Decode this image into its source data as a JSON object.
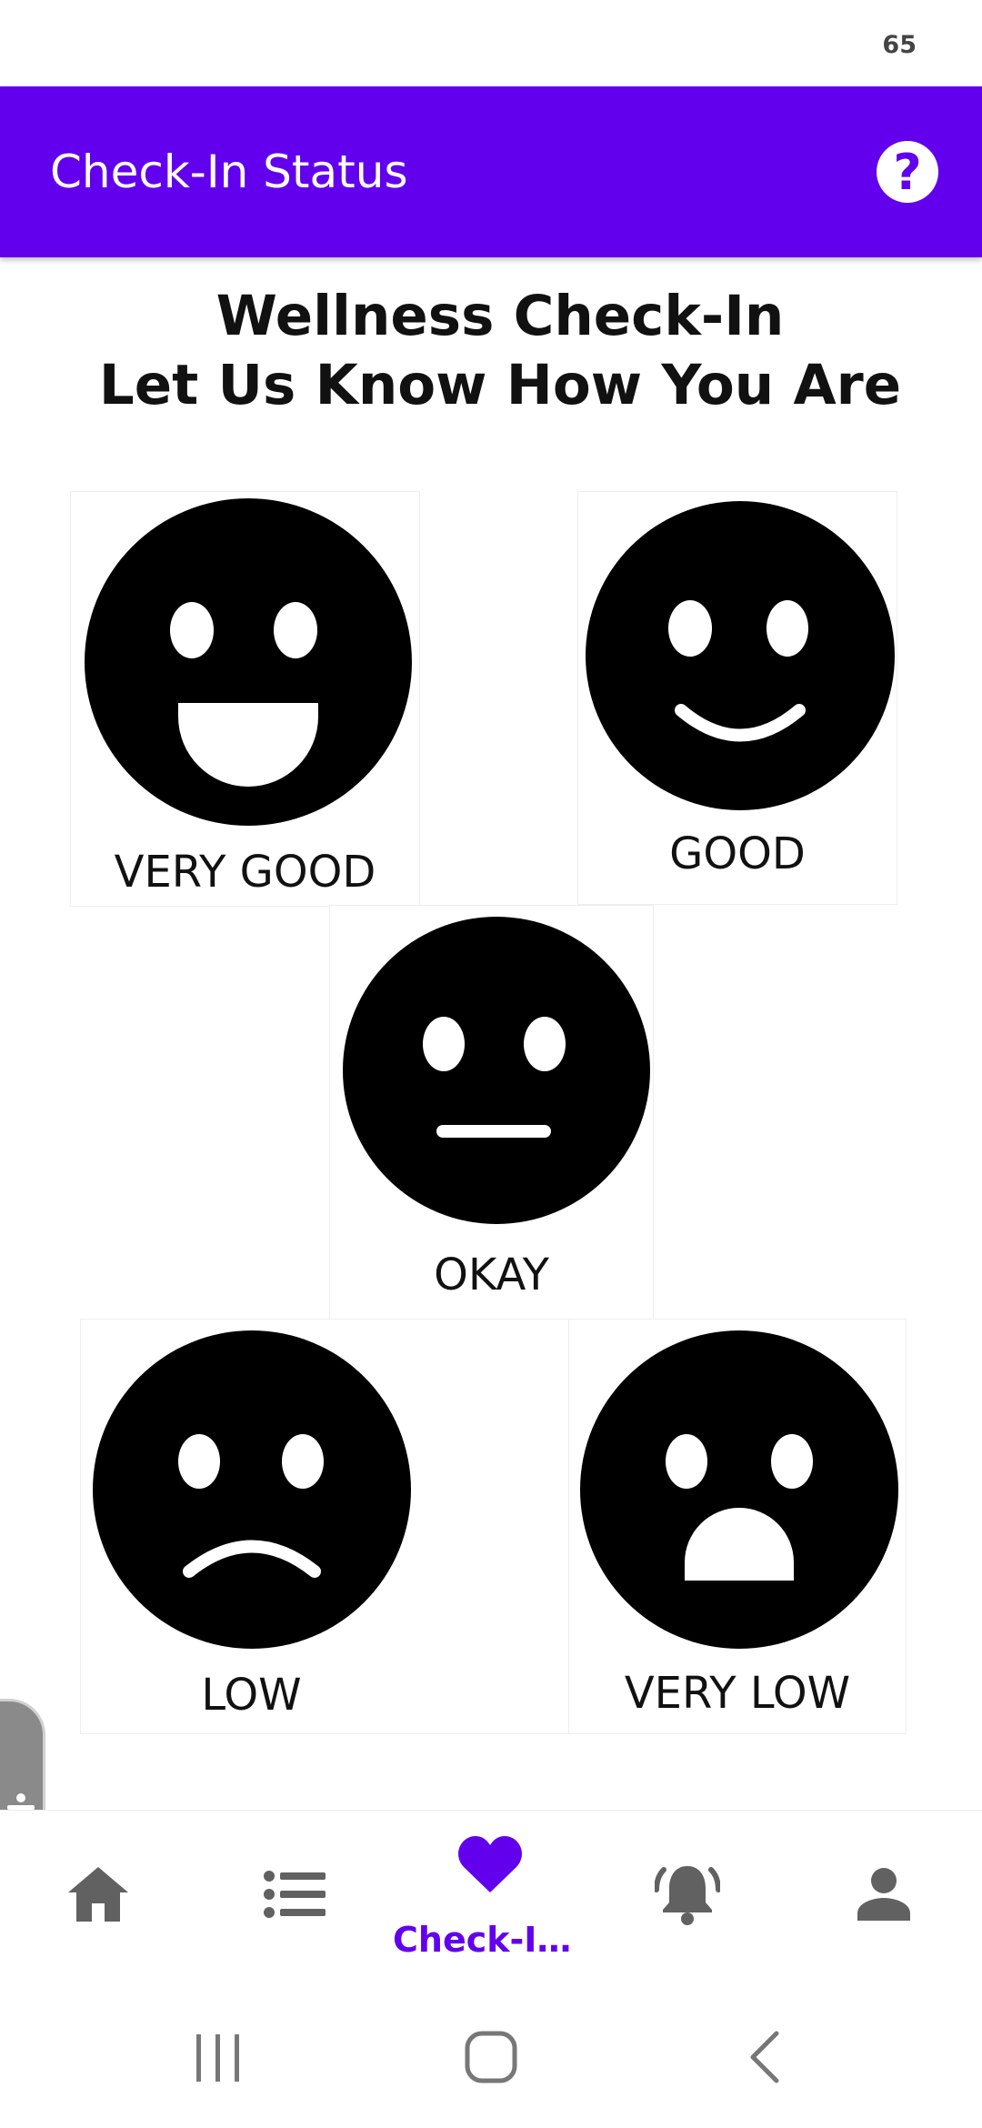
{
  "status_bar": {
    "indicator": "65"
  },
  "app_bar": {
    "title": "Check-In Status",
    "help_icon": "question-circle-icon"
  },
  "heading": {
    "line1": "Wellness Check-In",
    "line2": "Let Us Know How You Are"
  },
  "moods": [
    {
      "label": "VERY GOOD",
      "icon": "very-happy-face-icon"
    },
    {
      "label": "GOOD",
      "icon": "smiling-face-icon"
    },
    {
      "label": "OKAY",
      "icon": "neutral-face-icon"
    },
    {
      "label": "LOW",
      "icon": "frowning-face-icon"
    },
    {
      "label": "VERY LOW",
      "icon": "distressed-face-icon"
    }
  ],
  "bottom_nav": {
    "items": [
      {
        "icon": "home-icon",
        "label": ""
      },
      {
        "icon": "list-icon",
        "label": ""
      },
      {
        "icon": "heart-icon",
        "label": "Check-In..."
      },
      {
        "icon": "alarm-bell-icon",
        "label": ""
      },
      {
        "icon": "person-icon",
        "label": ""
      }
    ],
    "active_index": 2
  },
  "colors": {
    "primary": "#6200EE",
    "inactive_icon": "#616161",
    "face": "#000000"
  }
}
